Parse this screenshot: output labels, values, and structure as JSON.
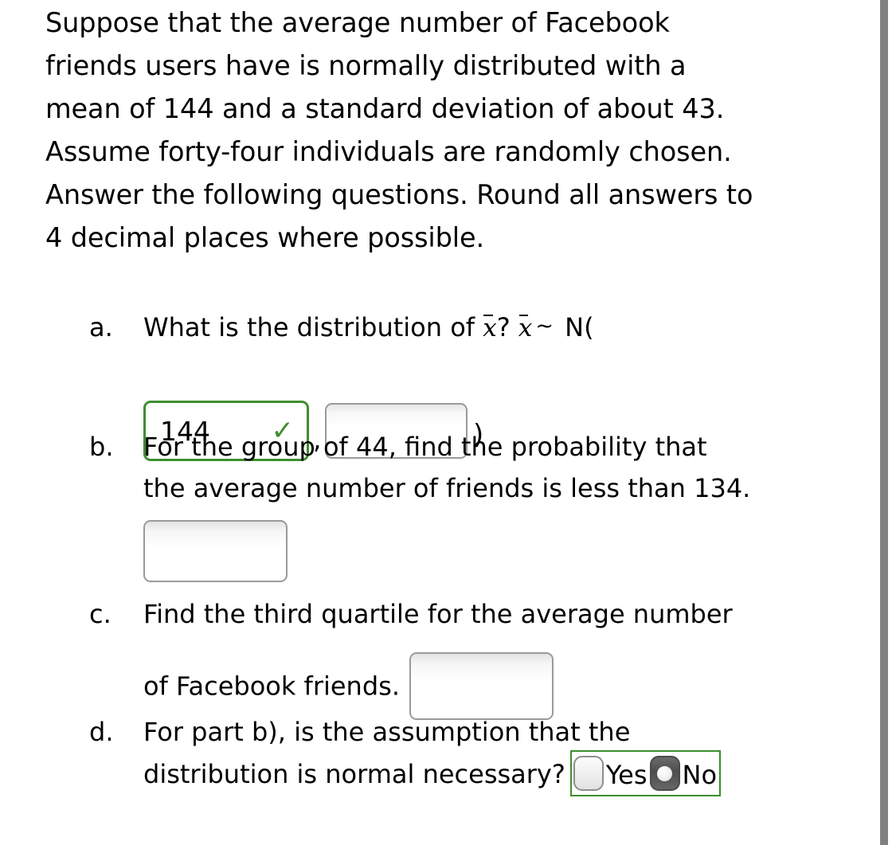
{
  "problem": {
    "intro": "Suppose that the average number of Facebook\nfriends users have is normally distributed with a\nmean of 144 and a standard deviation of about 43.\nAssume forty-four individuals are randomly chosen.\nAnswer the following questions. Round all answers to\n4 decimal places where possible."
  },
  "parts": {
    "a": {
      "marker": "a.",
      "text_before": "What is the distribution of ",
      "var1": "x",
      "question_mark": "? ",
      "var2": "x",
      "tilde": "~",
      "dist_open": " N(",
      "select_value": "144",
      "check_icon": "✓",
      "comma": ",",
      "input_value": "",
      "paren_close": ")"
    },
    "b": {
      "marker": "b.",
      "line1": "For the group of 44, find the probability that",
      "line2": "the average number of friends is less than 134.",
      "input_value": ""
    },
    "c": {
      "marker": "c.",
      "line1": "Find the third quartile for the average number",
      "line2": "of Facebook friends.",
      "input_value": ""
    },
    "d": {
      "marker": "d.",
      "line1": "For part b), is the assumption that the",
      "line2": "distribution is normal necessary?",
      "option_yes": "Yes",
      "option_no": "No",
      "selected": "No"
    }
  },
  "colors": {
    "correct_green": "#3e8e2e",
    "input_border_gray": "#9a9a9a",
    "scrollbar_gray": "#808080",
    "radio_selected_gray": "#4d4d4d",
    "text_black": "#000000"
  }
}
